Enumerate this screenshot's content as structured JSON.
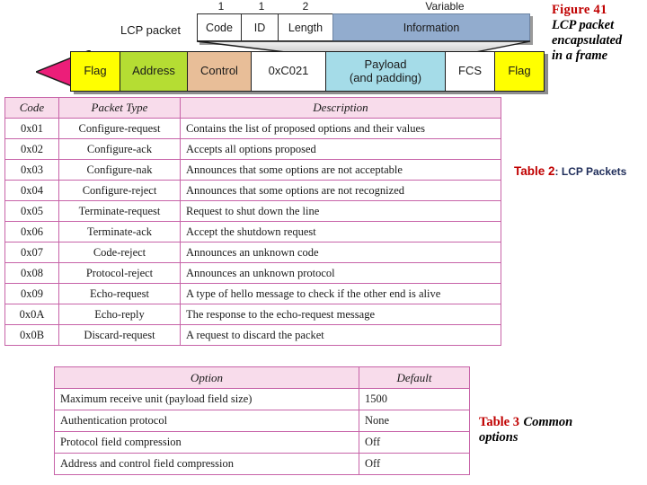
{
  "figure": {
    "caption_title": "Figure 41",
    "caption_body_line1": "LCP packet",
    "caption_body_line2": "encapsulated",
    "caption_body_line3": "in a frame",
    "lcp_row_label": "LCP packet",
    "size_labels": [
      "1",
      "1",
      "2",
      "Variable"
    ],
    "lcp_fields": [
      {
        "label": "Code",
        "size": "1"
      },
      {
        "label": "ID",
        "size": "1"
      },
      {
        "label": "Length",
        "size": "2"
      },
      {
        "label": "Information",
        "size": "Variable"
      }
    ],
    "frame_fields": [
      {
        "label": "Flag"
      },
      {
        "label": "Address"
      },
      {
        "label": "Control"
      },
      {
        "label": "0xC021"
      },
      {
        "label_line1": "Payload",
        "label_line2": "(and padding)"
      },
      {
        "label": "FCS"
      },
      {
        "label": "Flag"
      }
    ],
    "colors": {
      "flag": "#ffff00",
      "address": "#b5dd33",
      "control": "#e8be98",
      "protocol": "#ffffff",
      "payload": "#a5dce8",
      "fcs": "#ffffff",
      "information": "#92acce",
      "arrow": "#ec1e79"
    }
  },
  "table_lcp_packets": {
    "caption_title": "Table 2",
    "caption_body": ": LCP Packets",
    "headers": [
      "Code",
      "Packet Type",
      "Description"
    ],
    "rows": [
      [
        "0x01",
        "Configure-request",
        "Contains the list of proposed options and their values"
      ],
      [
        "0x02",
        "Configure-ack",
        "Accepts all options proposed"
      ],
      [
        "0x03",
        "Configure-nak",
        "Announces that some options are not acceptable"
      ],
      [
        "0x04",
        "Configure-reject",
        "Announces that some options are not recognized"
      ],
      [
        "0x05",
        "Terminate-request",
        "Request to shut down the line"
      ],
      [
        "0x06",
        "Terminate-ack",
        "Accept the shutdown request"
      ],
      [
        "0x07",
        "Code-reject",
        "Announces an unknown code"
      ],
      [
        "0x08",
        "Protocol-reject",
        "Announces an unknown protocol"
      ],
      [
        "0x09",
        "Echo-request",
        "A type of hello message to check if the other end is alive"
      ],
      [
        "0x0A",
        "Echo-reply",
        "The response to the echo-request message"
      ],
      [
        "0x0B",
        "Discard-request",
        "A request to discard the packet"
      ]
    ]
  },
  "table_common_options": {
    "caption_title": "Table 3",
    "caption_body_line1": "Common",
    "caption_body_line2": "options",
    "headers": [
      "Option",
      "Default"
    ],
    "rows": [
      [
        "Maximum receive unit (payload field size)",
        "1500"
      ],
      [
        "Authentication protocol",
        "None"
      ],
      [
        "Protocol field compression",
        "Off"
      ],
      [
        "Address and control field compression",
        "Off"
      ]
    ]
  },
  "theme": {
    "header_pink": "#f8dceb",
    "border_magenta": "#c763a8",
    "caption_red": "#c00000",
    "caption_navy": "#1f2d5a"
  }
}
